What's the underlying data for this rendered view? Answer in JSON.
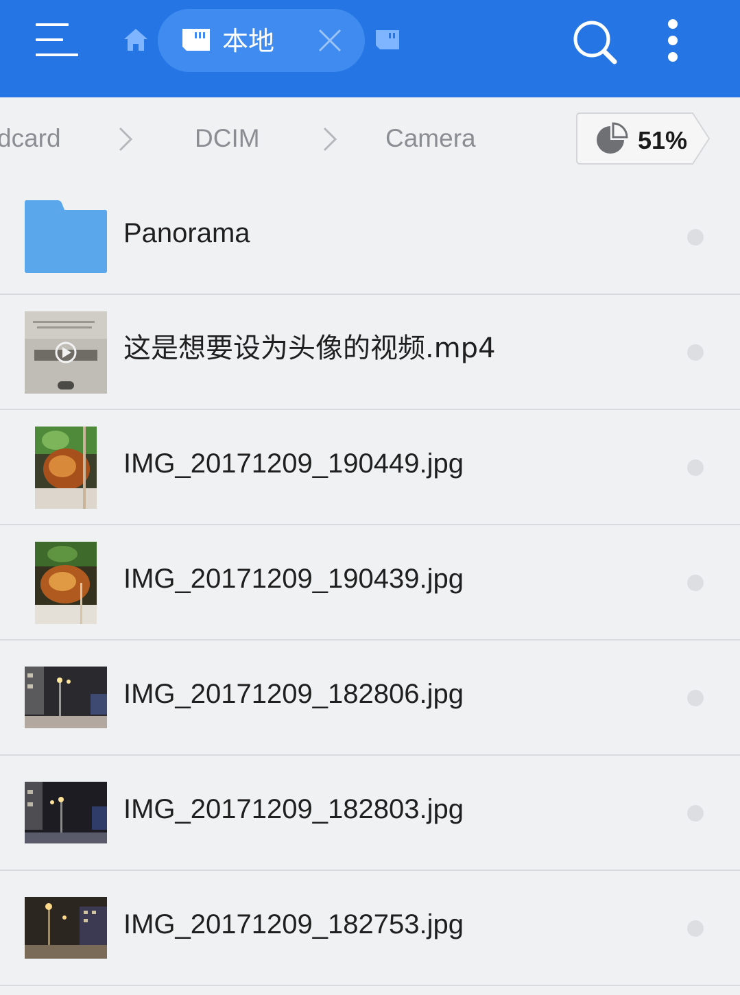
{
  "header": {
    "tab_label": "本地",
    "colors": {
      "bar": "#2576e4",
      "pill": "#3f8bf0",
      "icon_light": "#7fb4ff"
    },
    "icons": [
      "menu-icon",
      "home-icon",
      "sd-card-icon",
      "close-icon",
      "sd-card-icon",
      "search-icon",
      "more-vert-icon"
    ]
  },
  "breadcrumb": {
    "items": [
      "dcard",
      "DCIM",
      "Camera"
    ],
    "storage_percent": "51%"
  },
  "files": [
    {
      "name": "Panorama",
      "type": "folder"
    },
    {
      "name": "这是想要设为头像的视频.mp4",
      "type": "video"
    },
    {
      "name": "IMG_20171209_190449.jpg",
      "type": "image"
    },
    {
      "name": "IMG_20171209_190439.jpg",
      "type": "image"
    },
    {
      "name": "IMG_20171209_182806.jpg",
      "type": "image"
    },
    {
      "name": "IMG_20171209_182803.jpg",
      "type": "image"
    },
    {
      "name": "IMG_20171209_182753.jpg",
      "type": "image"
    }
  ]
}
